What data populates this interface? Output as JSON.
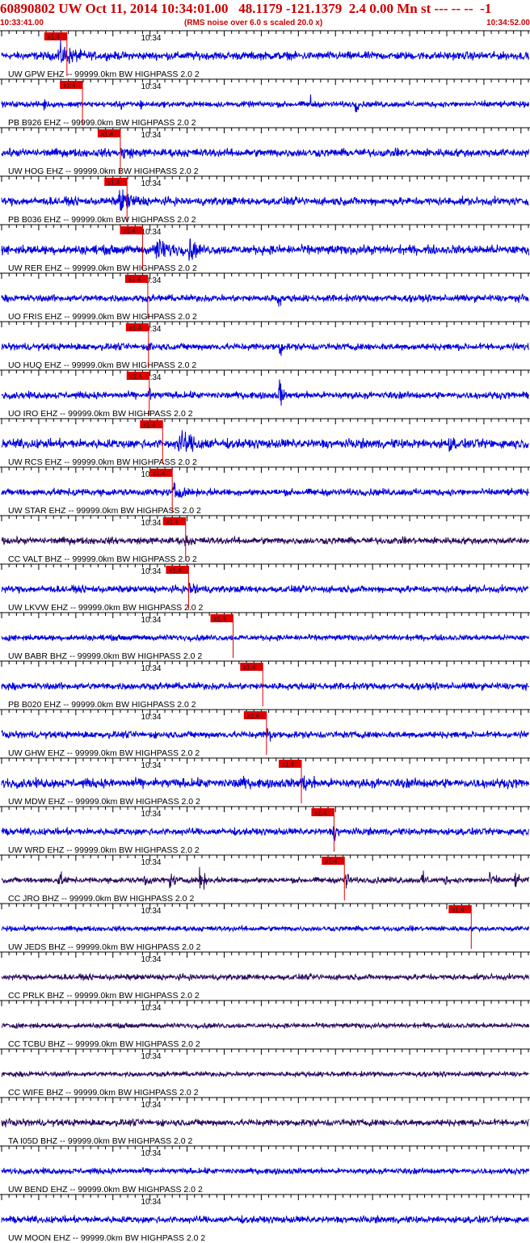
{
  "header": {
    "title": "60890802 UW Oct 11, 2014 10:34:01.00   48.1179 -121.1379  2.4 0.00 Mn st --- -- --  -1",
    "start_time": "10:33:41.00",
    "rms_note": "(RMS noise over 6.0 s scaled 20.0 x)",
    "end_time": "10:34:52.00"
  },
  "colors": {
    "header": "#cc0000",
    "pick": "#dd0000",
    "trace_blue": "#0000dd",
    "trace_purple": "#2a0a5e",
    "axis": "#000000"
  },
  "chart_data": {
    "type": "line",
    "title": "60890802 UW Oct 11, 2014 10:34:01.00   48.1179 -121.1379  2.4 0.00 Mn st --- -- --  -1",
    "x_unit": "seconds after 10:33:41.00",
    "xlim": [
      0,
      71
    ],
    "minute_mark": "10:34",
    "minute_mark_seconds": 19,
    "pick_label": "x1.4",
    "traces": [
      {
        "label": "UW GPW EHZ -- 99999.0km BW  HIGHPASS  2.0  2",
        "color": "blue",
        "pick_s": 8.8,
        "amp": 0.35,
        "events": [
          [
            7.5,
            6.0,
            1.0,
            8.0
          ]
        ]
      },
      {
        "label": "PB B926 EHZ -- 99999.0km BW  HIGHPASS  2.0  2",
        "color": "blue",
        "pick_s": 10.9,
        "amp": 0.25,
        "events": [
          [
            41.5,
            0.6,
            0.9,
            12.0
          ],
          [
            47.5,
            0.6,
            0.9,
            10.0
          ],
          [
            5.5,
            0.5,
            0.6,
            12.0
          ],
          [
            10.0,
            0.5,
            0.5,
            10.0
          ],
          [
            16.0,
            0.5,
            0.5,
            10.0
          ],
          [
            18.5,
            0.5,
            0.5,
            10.0
          ],
          [
            65.0,
            2.0,
            0.3,
            8.0
          ]
        ]
      },
      {
        "label": "UW HOG EHZ -- 99999.0km BW  HIGHPASS  2.0  2",
        "color": "blue",
        "pick_s": 16.0,
        "amp": 0.35,
        "events": [
          [
            16.0,
            5.0,
            0.5,
            8.0
          ]
        ]
      },
      {
        "label": "PB B036 EHZ -- 99999.0km BW  HIGHPASS  2.0  2",
        "color": "blue",
        "pick_s": 16.9,
        "amp": 0.35,
        "events": [
          [
            15.5,
            6.0,
            1.0,
            5.0
          ]
        ]
      },
      {
        "label": "UW RER EHZ -- 99999.0km BW  HIGHPASS  2.0  2",
        "color": "blue",
        "pick_s": 19.0,
        "amp": 0.4,
        "events": [
          [
            20.5,
            6.0,
            1.0,
            5.0
          ],
          [
            25.0,
            3.0,
            1.0,
            5.0
          ]
        ]
      },
      {
        "label": "UO FRIS EHZ -- 99999.0km BW  HIGHPASS  2.0  2",
        "color": "blue",
        "pick_s": 19.7,
        "amp": 0.3,
        "events": [
          [
            37.0,
            0.5,
            1.3,
            12.0
          ]
        ]
      },
      {
        "label": "UO HUQ EHZ -- 99999.0km BW  HIGHPASS  2.0  2",
        "color": "blue",
        "pick_s": 19.8,
        "amp": 0.3,
        "events": [
          [
            37.3,
            0.5,
            1.1,
            12.0
          ],
          [
            19.8,
            1.0,
            0.7,
            10.0
          ]
        ]
      },
      {
        "label": "UO IRO EHZ -- 99999.0km BW  HIGHPASS  2.0  2",
        "color": "blue",
        "pick_s": 19.9,
        "amp": 0.3,
        "events": [
          [
            37.3,
            0.5,
            1.8,
            12.0
          ],
          [
            19.8,
            1.0,
            0.9,
            10.0
          ]
        ]
      },
      {
        "label": "UW RCS EHZ -- 99999.0km BW  HIGHPASS  2.0  2",
        "color": "blue",
        "pick_s": 21.7,
        "amp": 0.4,
        "events": [
          [
            23.5,
            8.0,
            1.0,
            4.0
          ],
          [
            60.0,
            3.0,
            0.6,
            5.0
          ]
        ]
      },
      {
        "label": "UW STAR EHZ -- 99999.0km BW  HIGHPASS  2.0  2",
        "color": "blue",
        "pick_s": 23.0,
        "amp": 0.3,
        "events": [
          [
            23.0,
            3.0,
            0.8,
            6.0
          ],
          [
            9.5,
            1.5,
            0.4,
            6.0
          ]
        ]
      },
      {
        "label": "CC VALT BHZ -- 99999.0km BW  HIGHPASS  2.0  2",
        "color": "purple",
        "pick_s": 24.8,
        "amp": 0.3,
        "events": [
          [
            24.5,
            2.5,
            0.5,
            6.0
          ]
        ]
      },
      {
        "label": "UW LKVW EHZ -- 99999.0km BW  HIGHPASS  2.0  2",
        "color": "blue",
        "pick_s": 25.2,
        "amp": 0.3,
        "events": [
          [
            25.0,
            5.0,
            0.6,
            4.0
          ]
        ]
      },
      {
        "label": "UW BABR BHZ -- 99999.0km BW  HIGHPASS  2.0  2",
        "color": "blue",
        "pick_s": 31.2,
        "amp": 0.25,
        "events": []
      },
      {
        "label": "PB B020 EHZ -- 99999.0km BW  HIGHPASS  2.0  2",
        "color": "blue",
        "pick_s": 35.2,
        "amp": 0.3,
        "events": []
      },
      {
        "label": "UW GHW EHZ -- 99999.0km BW  HIGHPASS  2.0  2",
        "color": "blue",
        "pick_s": 35.7,
        "amp": 0.3,
        "events": [
          [
            35.5,
            1.5,
            0.9,
            8.0
          ]
        ]
      },
      {
        "label": "UW MDW EHZ -- 99999.0km BW  HIGHPASS  2.0  2",
        "color": "blue",
        "pick_s": 40.4,
        "amp": 0.4,
        "events": [
          [
            31.5,
            4.0,
            0.6,
            5.0
          ],
          [
            40.0,
            5.0,
            0.7,
            5.0
          ]
        ]
      },
      {
        "label": "UW WRD EHZ -- 99999.0km BW  HIGHPASS  2.0  2",
        "color": "blue",
        "pick_s": 44.8,
        "amp": 0.3,
        "events": [
          [
            44.5,
            1.5,
            0.8,
            8.0
          ]
        ]
      },
      {
        "label": "CC JRO BHZ -- 99999.0km BW  HIGHPASS  2.0  2",
        "color": "purple",
        "pick_s": 46.2,
        "amp": 0.25,
        "events": [
          [
            7.5,
            1.5,
            0.8,
            6.0
          ],
          [
            19.0,
            2.0,
            0.6,
            6.0
          ],
          [
            22.5,
            1.5,
            0.7,
            6.0
          ],
          [
            26.5,
            1.8,
            1.0,
            6.0
          ],
          [
            46.0,
            1.5,
            1.0,
            6.0
          ],
          [
            50.0,
            1.0,
            0.5,
            6.0
          ],
          [
            53.5,
            1.0,
            0.4,
            6.0
          ],
          [
            56.5,
            1.5,
            0.7,
            6.0
          ],
          [
            59.5,
            1.0,
            0.5,
            6.0
          ],
          [
            65.5,
            2.5,
            0.6,
            6.0
          ],
          [
            69.0,
            1.5,
            0.6,
            6.0
          ]
        ]
      },
      {
        "label": "UW JEDS BHZ -- 99999.0km BW  HIGHPASS  2.0  2",
        "color": "blue",
        "pick_s": 63.3,
        "amp": 0.22,
        "events": []
      },
      {
        "label": "CC PRLK BHZ -- 99999.0km BW  HIGHPASS  2.0  2",
        "color": "purple",
        "pick_s": null,
        "amp": 0.25,
        "events": []
      },
      {
        "label": "CC TCBU BHZ -- 99999.0km BW  HIGHPASS  2.0  2",
        "color": "purple",
        "pick_s": null,
        "amp": 0.22,
        "events": []
      },
      {
        "label": "CC WIFE BHZ -- 99999.0km BW  HIGHPASS  2.0  2",
        "color": "purple",
        "pick_s": null,
        "amp": 0.22,
        "events": []
      },
      {
        "label": "TA I05D BHZ -- 99999.0km BW  HIGHPASS  2.0  2",
        "color": "purple",
        "pick_s": null,
        "amp": 0.3,
        "events": []
      },
      {
        "label": "UW BEND EHZ -- 99999.0km BW  HIGHPASS  2.0  2",
        "color": "blue",
        "pick_s": null,
        "amp": 0.25,
        "events": []
      },
      {
        "label": "UW MOON EHZ -- 99999.0km BW  HIGHPASS  2.0  2",
        "color": "blue",
        "pick_s": null,
        "amp": 0.3,
        "events": []
      }
    ]
  }
}
